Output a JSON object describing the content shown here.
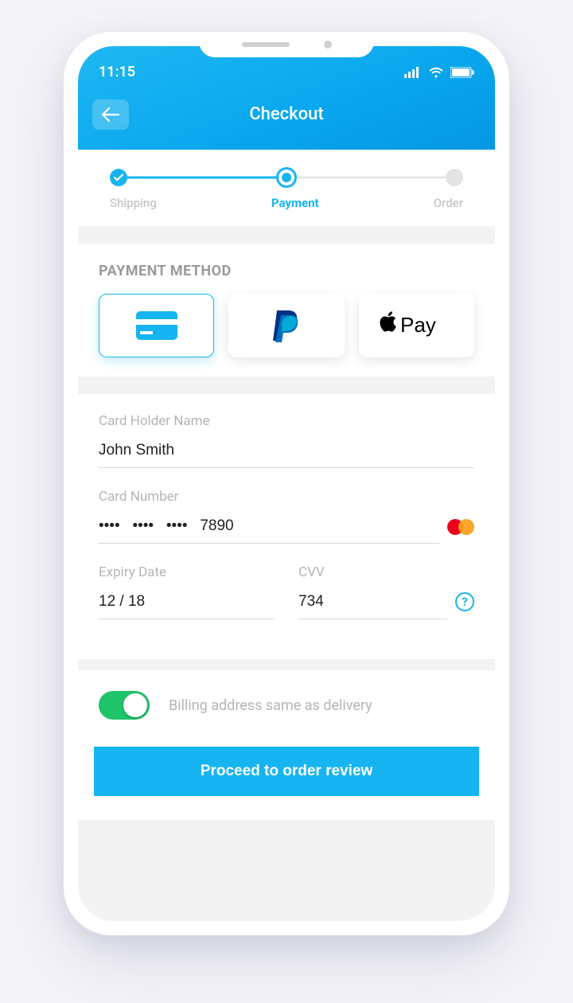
{
  "status": {
    "time": "11:15"
  },
  "header": {
    "title": "Checkout"
  },
  "steps": {
    "items": [
      {
        "label": "Shipping",
        "state": "done"
      },
      {
        "label": "Payment",
        "state": "active"
      },
      {
        "label": "Order",
        "state": "pending"
      }
    ]
  },
  "payment": {
    "section_title": "PAYMENT METHOD",
    "methods": [
      {
        "id": "card",
        "icon": "credit-card-icon",
        "selected": true
      },
      {
        "id": "paypal",
        "icon": "paypal-icon",
        "selected": false
      },
      {
        "id": "applepay",
        "icon": "apple-pay-icon",
        "selected": false
      }
    ],
    "card_holder": {
      "label": "Card Holder Name",
      "value": "John Smith"
    },
    "card_number": {
      "label": "Card Number",
      "value": "••••   ••••   ••••   7890",
      "brand": "mastercard"
    },
    "expiry": {
      "label": "Expiry Date",
      "value": "12 / 18"
    },
    "cvv": {
      "label": "CVV",
      "value": "734"
    }
  },
  "billing": {
    "same_as_delivery_label": "Billing address same as delivery",
    "same_as_delivery": true
  },
  "cta": {
    "label": "Proceed to order review"
  },
  "colors": {
    "accent": "#16b4f1",
    "toggle_on": "#1fc36a"
  }
}
